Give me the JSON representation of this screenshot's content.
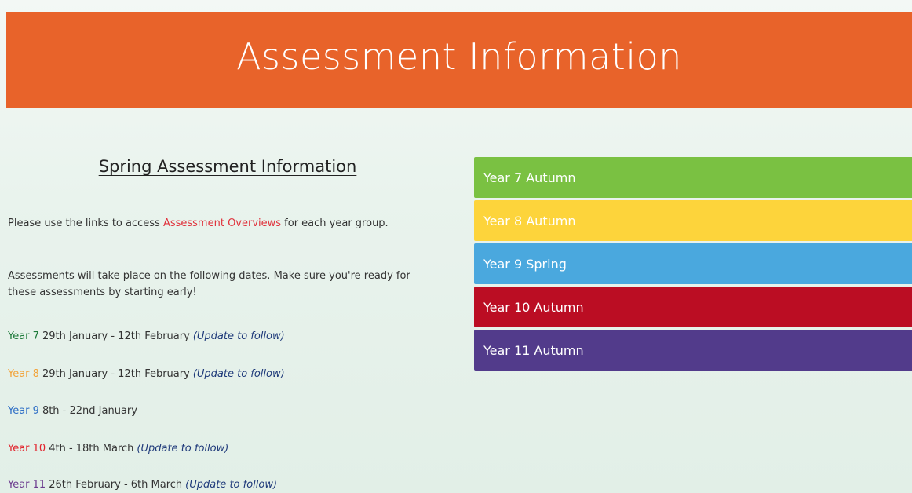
{
  "header": {
    "title": "Assessment Information"
  },
  "left": {
    "heading": "Spring Assessment Information",
    "intro_before": "Please use the links to access ",
    "intro_link": "Assessment Overviews",
    "intro_after": " for each year group.",
    "dates_intro": "Assessments will take place on the following dates. Make sure you're ready for these assessments by starting early!",
    "schedule": [
      {
        "label": "Year 7",
        "dates": "29th January - 12th February",
        "note": "(Update to follow)",
        "color": "#1e7a3a"
      },
      {
        "label": "Year 8",
        "dates": "29th January - 12th February",
        "note": "(Update to follow)",
        "color": "#f2a33a"
      },
      {
        "label": "Year 9",
        "dates": "8th - 22nd January",
        "note": "",
        "color": "#2f6fc6"
      },
      {
        "label": "Year 10",
        "dates": "4th - 18th March",
        "note": "(Update to follow)",
        "color": "#e2222b"
      },
      {
        "label": "Year 11",
        "dates": "26th February - 6th March",
        "note": "(Update to follow)",
        "color": "#6b3a8e"
      }
    ]
  },
  "tabs": [
    {
      "label": "Year 7 Autumn",
      "color": "#7ac142"
    },
    {
      "label": "Year 8 Autumn",
      "color": "#fdd43b"
    },
    {
      "label": "Year 9 Spring",
      "color": "#4aa8de"
    },
    {
      "label": "Year 10 Autumn",
      "color": "#bb0d23"
    },
    {
      "label": "Year 11 Autumn",
      "color": "#523b8b"
    }
  ],
  "colors": {
    "header_bg": "#e8632a",
    "link_red": "#e0323c",
    "note_blue": "#1f3a7a"
  }
}
